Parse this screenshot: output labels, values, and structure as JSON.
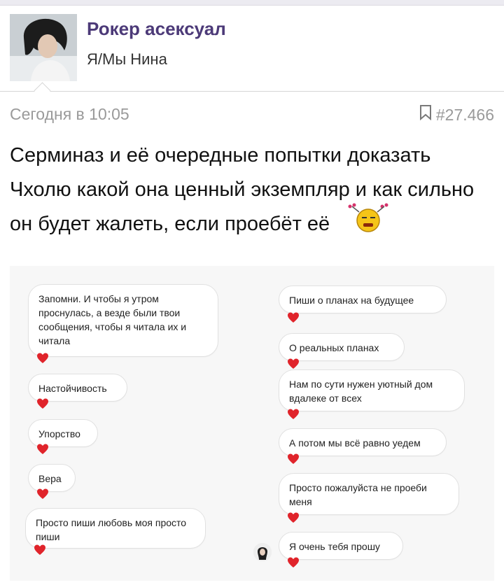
{
  "header": {
    "group_name": "Рокер асексуал",
    "subtitle": "Я/Мы Нина"
  },
  "post": {
    "date": "Сегодня в 10:05",
    "id": "#27.466",
    "text": "Серминаз и её очередные попытки доказать Чхолю какой она ценный экземпляр и как сильно он будет жалеть, если проебёт её"
  },
  "chat": {
    "left": [
      "Запомни. И чтобы я утром проснулась, а везде были твои сообщения, чтобы я читала их и читала",
      "Настойчивость",
      "Упорство",
      "Вера",
      "Просто пиши любовь моя просто пиши"
    ],
    "right": [
      "Пиши о планах на будущее",
      "О реальных планах",
      "Нам по сути нужен уютный дом вдалеке от всех",
      "А потом мы всё равно уедем",
      "Просто пожалуйста не проеби меня",
      "Я очень тебя прошу"
    ]
  },
  "colors": {
    "accent": "#4c3a78",
    "meta": "#9a9a9a",
    "heart": "#e0242b"
  },
  "icons": [
    "bookmark-icon",
    "heart-icon",
    "sleepy-emoji-icon"
  ]
}
